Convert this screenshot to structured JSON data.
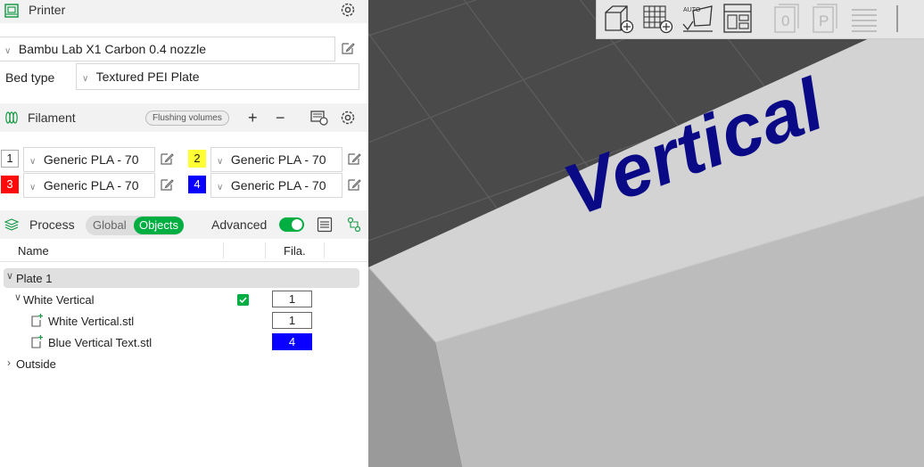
{
  "printer": {
    "title": "Printer",
    "preset": "Bambu Lab X1 Carbon 0.4 nozzle",
    "bed_type_label": "Bed type",
    "bed_type": "Textured PEI Plate"
  },
  "filament": {
    "title": "Filament",
    "flushing_label": "Flushing volumes",
    "add_symbol": "+",
    "remove_symbol": "−",
    "slots": [
      {
        "num": "1",
        "name": "Generic PLA - 70",
        "color": "#ffffff"
      },
      {
        "num": "2",
        "name": "Generic PLA - 70",
        "color": "#ffff33"
      },
      {
        "num": "3",
        "name": "Generic PLA - 70",
        "color": "#ff0a0a"
      },
      {
        "num": "4",
        "name": "Generic PLA - 70",
        "color": "#0a00ff"
      }
    ]
  },
  "process": {
    "title": "Process",
    "global_label": "Global",
    "objects_label": "Objects",
    "advanced_label": "Advanced",
    "advanced_on": true
  },
  "object_list": {
    "col_name": "Name",
    "col_fila": "Fila.",
    "plate": "Plate 1",
    "object": {
      "name": "White Vertical",
      "fila": "1",
      "checked": true
    },
    "parts": [
      {
        "name": "White Vertical.stl",
        "fila": "1"
      },
      {
        "name": "Blue Vertical Text.stl",
        "fila": "4"
      }
    ],
    "outside": "Outside"
  },
  "viewport": {
    "text_on_object": "Vertical",
    "toolbar_icons": [
      "add-cube-icon",
      "add-grid-plate-icon",
      "auto-orient-icon",
      "layout-icon",
      "plate-0-icon",
      "plate-p-icon",
      "layers-icon"
    ],
    "auto_label": "AUTO",
    "plate_0_label": "0",
    "plate_p_label": "P"
  },
  "colors": {
    "accent": "#00ae42",
    "text_blue": "#0a0a86",
    "background_dark": "#4a4a4a"
  }
}
